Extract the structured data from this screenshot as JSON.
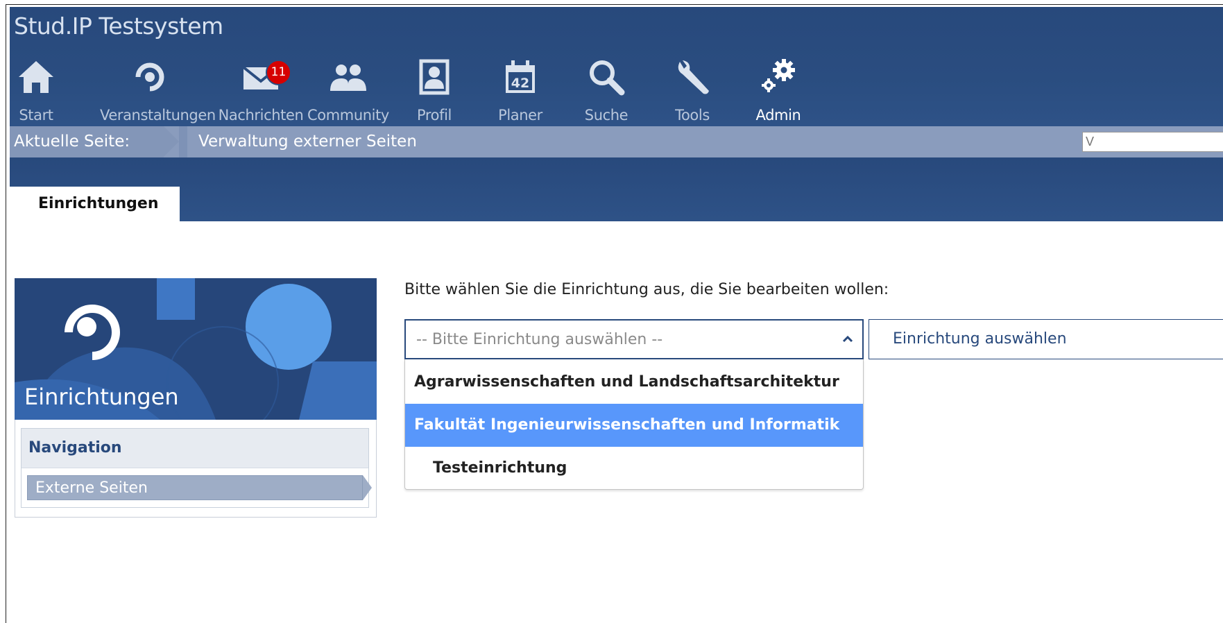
{
  "header": {
    "site_title": "Stud.IP Testsystem",
    "nav": [
      {
        "label": "Start",
        "icon": "home-icon"
      },
      {
        "label": "Veranstaltungen",
        "icon": "seminar-icon"
      },
      {
        "label": "Nachrichten",
        "icon": "mail-icon",
        "badge": "11"
      },
      {
        "label": "Community",
        "icon": "community-icon"
      },
      {
        "label": "Profil",
        "icon": "profile-icon"
      },
      {
        "label": "Planer",
        "icon": "calendar-icon",
        "icon_text": "42"
      },
      {
        "label": "Suche",
        "icon": "search-icon"
      },
      {
        "label": "Tools",
        "icon": "wrench-icon"
      },
      {
        "label": "Admin",
        "icon": "admin-gears-icon",
        "active": true
      }
    ]
  },
  "breadcrumb": {
    "label": "Aktuelle Seite:",
    "page": "Verwaltung externer Seiten",
    "search_placeholder": "V"
  },
  "tabs": [
    {
      "label": "Einrichtungen",
      "active": true
    }
  ],
  "sidebar": {
    "title": "Einrichtungen",
    "navigation_header": "Navigation",
    "items": [
      {
        "label": "Externe Seiten",
        "active": true
      }
    ]
  },
  "main": {
    "prompt": "Bitte wählen Sie die Einrichtung aus, die Sie bearbeiten wollen:",
    "select_placeholder": "-- Bitte Einrichtung auswählen --",
    "dropdown_options": [
      {
        "label": "Agrarwissenschaften und Landschaftsarchitektur",
        "type": "group"
      },
      {
        "label": "Fakultät Ingenieurwissenschaften und Informatik",
        "type": "highlighted"
      },
      {
        "label": "Testeinrichtung",
        "type": "option"
      }
    ],
    "select_button": "Einrichtung auswählen"
  },
  "colors": {
    "header_bg": "#28497c",
    "breadcrumb_bg": "#8a9cbd",
    "highlight": "#5897fb",
    "badge": "#d60000"
  }
}
